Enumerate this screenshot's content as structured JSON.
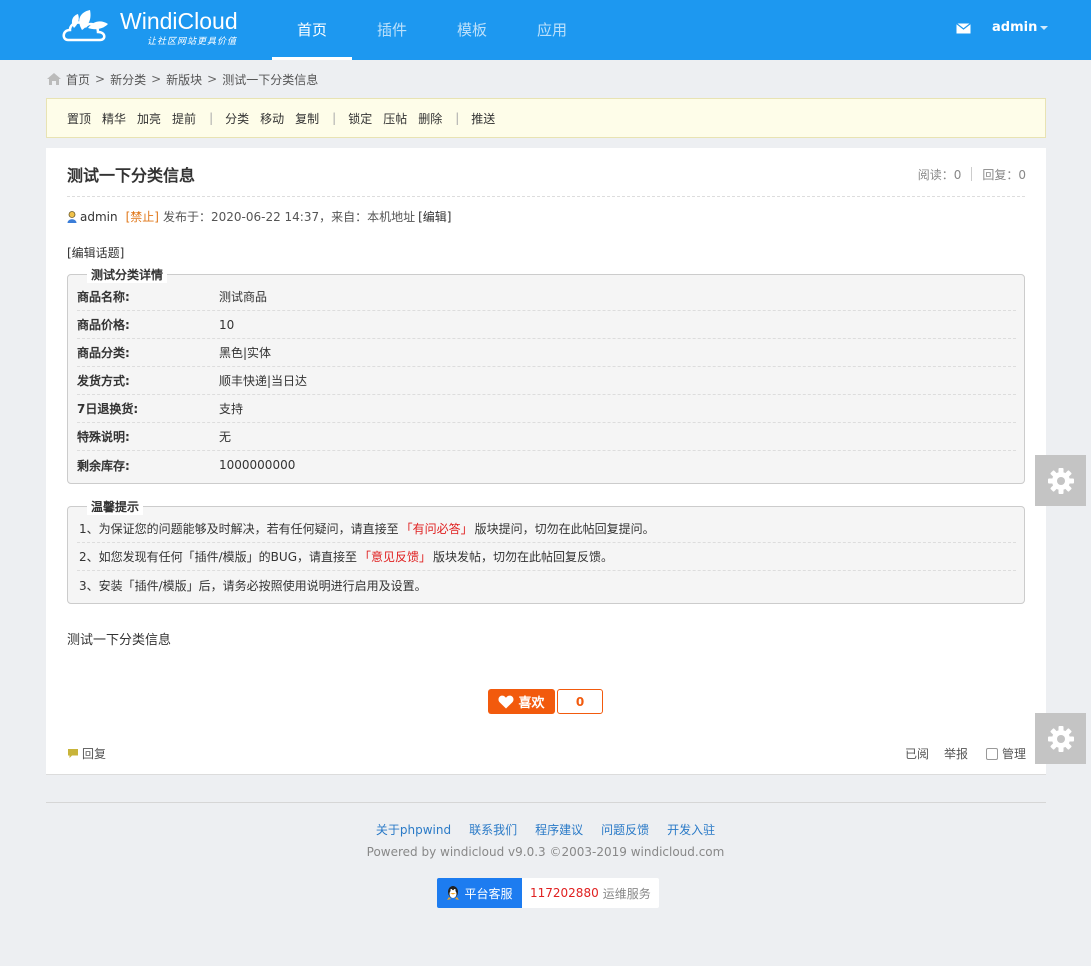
{
  "header": {
    "logo_text": "WindiCloud",
    "logo_slogan": "让社区网站更具价值",
    "nav": [
      {
        "label": "首页",
        "active": true
      },
      {
        "label": "插件",
        "active": false
      },
      {
        "label": "模板",
        "active": false
      },
      {
        "label": "应用",
        "active": false
      }
    ],
    "username": "admin",
    "icons": {
      "mail": "mail-icon"
    }
  },
  "breadcrumb": [
    "首页",
    "新分类",
    "新版块",
    "测试一下分类信息"
  ],
  "toolbar": {
    "group1": [
      "置顶",
      "精华",
      "加亮",
      "提前"
    ],
    "group2": [
      "分类",
      "移动",
      "复制"
    ],
    "group3": [
      "锁定",
      "压帖",
      "删除"
    ],
    "group4": [
      "推送"
    ],
    "separator": "|"
  },
  "post": {
    "title": "测试一下分类信息",
    "read_label": "阅读：0",
    "reply_label": "回复：0",
    "author": "admin",
    "ban_label": "[禁止]",
    "posted_text": "发布于：2020-06-22 14:37，来自：本机地址",
    "edit_label": "[编辑]",
    "edit_topic": "[编辑话题]",
    "content": "测试一下分类信息"
  },
  "details": {
    "legend": "测试分类详情",
    "rows": [
      {
        "key": "商品名称:",
        "value": "测试商品"
      },
      {
        "key": "商品价格:",
        "value": "10"
      },
      {
        "key": "商品分类:",
        "value": "黑色|实体"
      },
      {
        "key": "发货方式:",
        "value": "顺丰快递|当日达"
      },
      {
        "key": "7日退换货:",
        "value": "支持"
      },
      {
        "key": "特殊说明:",
        "value": "无"
      },
      {
        "key": "剩余库存:",
        "value": "1000000000"
      }
    ]
  },
  "tips": {
    "legend": "温馨提示",
    "t1_a": "1、为保证您的问题能够及时解决，若有任何疑问，请直接至",
    "t1_link": "「有问必答」",
    "t1_b": "版块提问，切勿在此帖回复提问。",
    "t2_a": "2、如您发现有任何「插件/模版」的BUG，请直接至",
    "t2_link": "「意见反馈」",
    "t2_b": "版块发帖，切勿在此帖回复反馈。",
    "t3": "3、安装「插件/模版」后，请务必按照使用说明进行启用及设置。"
  },
  "like": {
    "label": "喜欢",
    "count": "0"
  },
  "bottom": {
    "reply": "回复",
    "read": "已阅",
    "report": "举报",
    "manage": "管理"
  },
  "footer": {
    "links": [
      "关于phpwind",
      "联系我们",
      "程序建议",
      "问题反馈",
      "开发入驻"
    ],
    "powered": "Powered by windicloud v9.0.3 ©2003-2019 windicloud.com",
    "qq_label": "平台客服",
    "qq_number": "117202880",
    "service_label": "运维服务"
  },
  "colors": {
    "header_bg": "#1d98f0",
    "like_orange": "#f25a0d",
    "warn_red": "#e02020",
    "link_blue": "#2a7ac7"
  }
}
